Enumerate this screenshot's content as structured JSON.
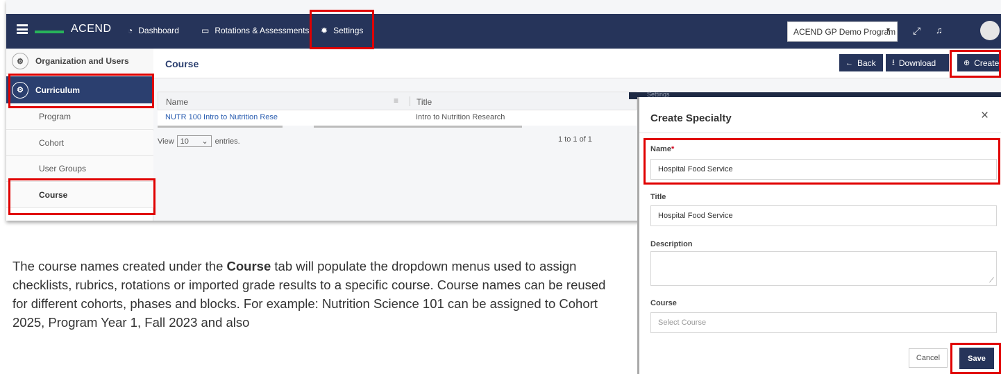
{
  "nav": {
    "app_title": "ACEND",
    "items": [
      {
        "label": "Dashboard",
        "icon": "dashboard-icon"
      },
      {
        "label": "Rotations & Assessments",
        "icon": "monitor-icon"
      },
      {
        "label": "Settings",
        "icon": "gear-icon"
      }
    ],
    "program_select": "ACEND GP Demo Program"
  },
  "sidebar": {
    "sections": [
      {
        "label": "Organization and Users",
        "icon": "organization-icon"
      },
      {
        "label": "Curriculum",
        "icon": "curriculum-icon"
      }
    ],
    "items": [
      "Program",
      "Cohort",
      "User Groups",
      "Course"
    ]
  },
  "page": {
    "title": "Course",
    "buttons": {
      "back": "Back",
      "download": "Download",
      "create": "Create"
    }
  },
  "table": {
    "columns": [
      "Name",
      "Title"
    ],
    "rows": [
      {
        "name": "NUTR 100 Intro to Nutrition Rese",
        "title": "Intro to Nutrition Research"
      }
    ],
    "pager": {
      "view": "View",
      "entries_value": "10",
      "entries_label": "entries.",
      "range": "1 to 1 of 1"
    }
  },
  "overlay": {
    "settings_label": "Settings"
  },
  "modal": {
    "title": "Create Specialty",
    "close": "×",
    "fields": {
      "name": {
        "label": "Name",
        "required_mark": "*",
        "value": "Hospital Food Service"
      },
      "title": {
        "label": "Title",
        "value": "Hospital Food Service"
      },
      "description": {
        "label": "Description",
        "value": ""
      },
      "course": {
        "label": "Course",
        "placeholder": "Select Course"
      }
    },
    "buttons": {
      "cancel": "Cancel",
      "save": "Save"
    }
  },
  "caption": {
    "part1": "The course names created under the ",
    "bold": "Course",
    "part2": " tab will populate the dropdown menus used to assign checklists, rubrics, rotations or imported grade results to a specific course. Course names can be reused for different cohorts, phases and blocks. For example: Nutrition Science 101 can be assigned to Cohort 2025, Program Year 1, Fall 2023 and also"
  },
  "colors": {
    "navy": "#26345a",
    "highlight": "#e00000",
    "accent_green": "#28b35a"
  }
}
